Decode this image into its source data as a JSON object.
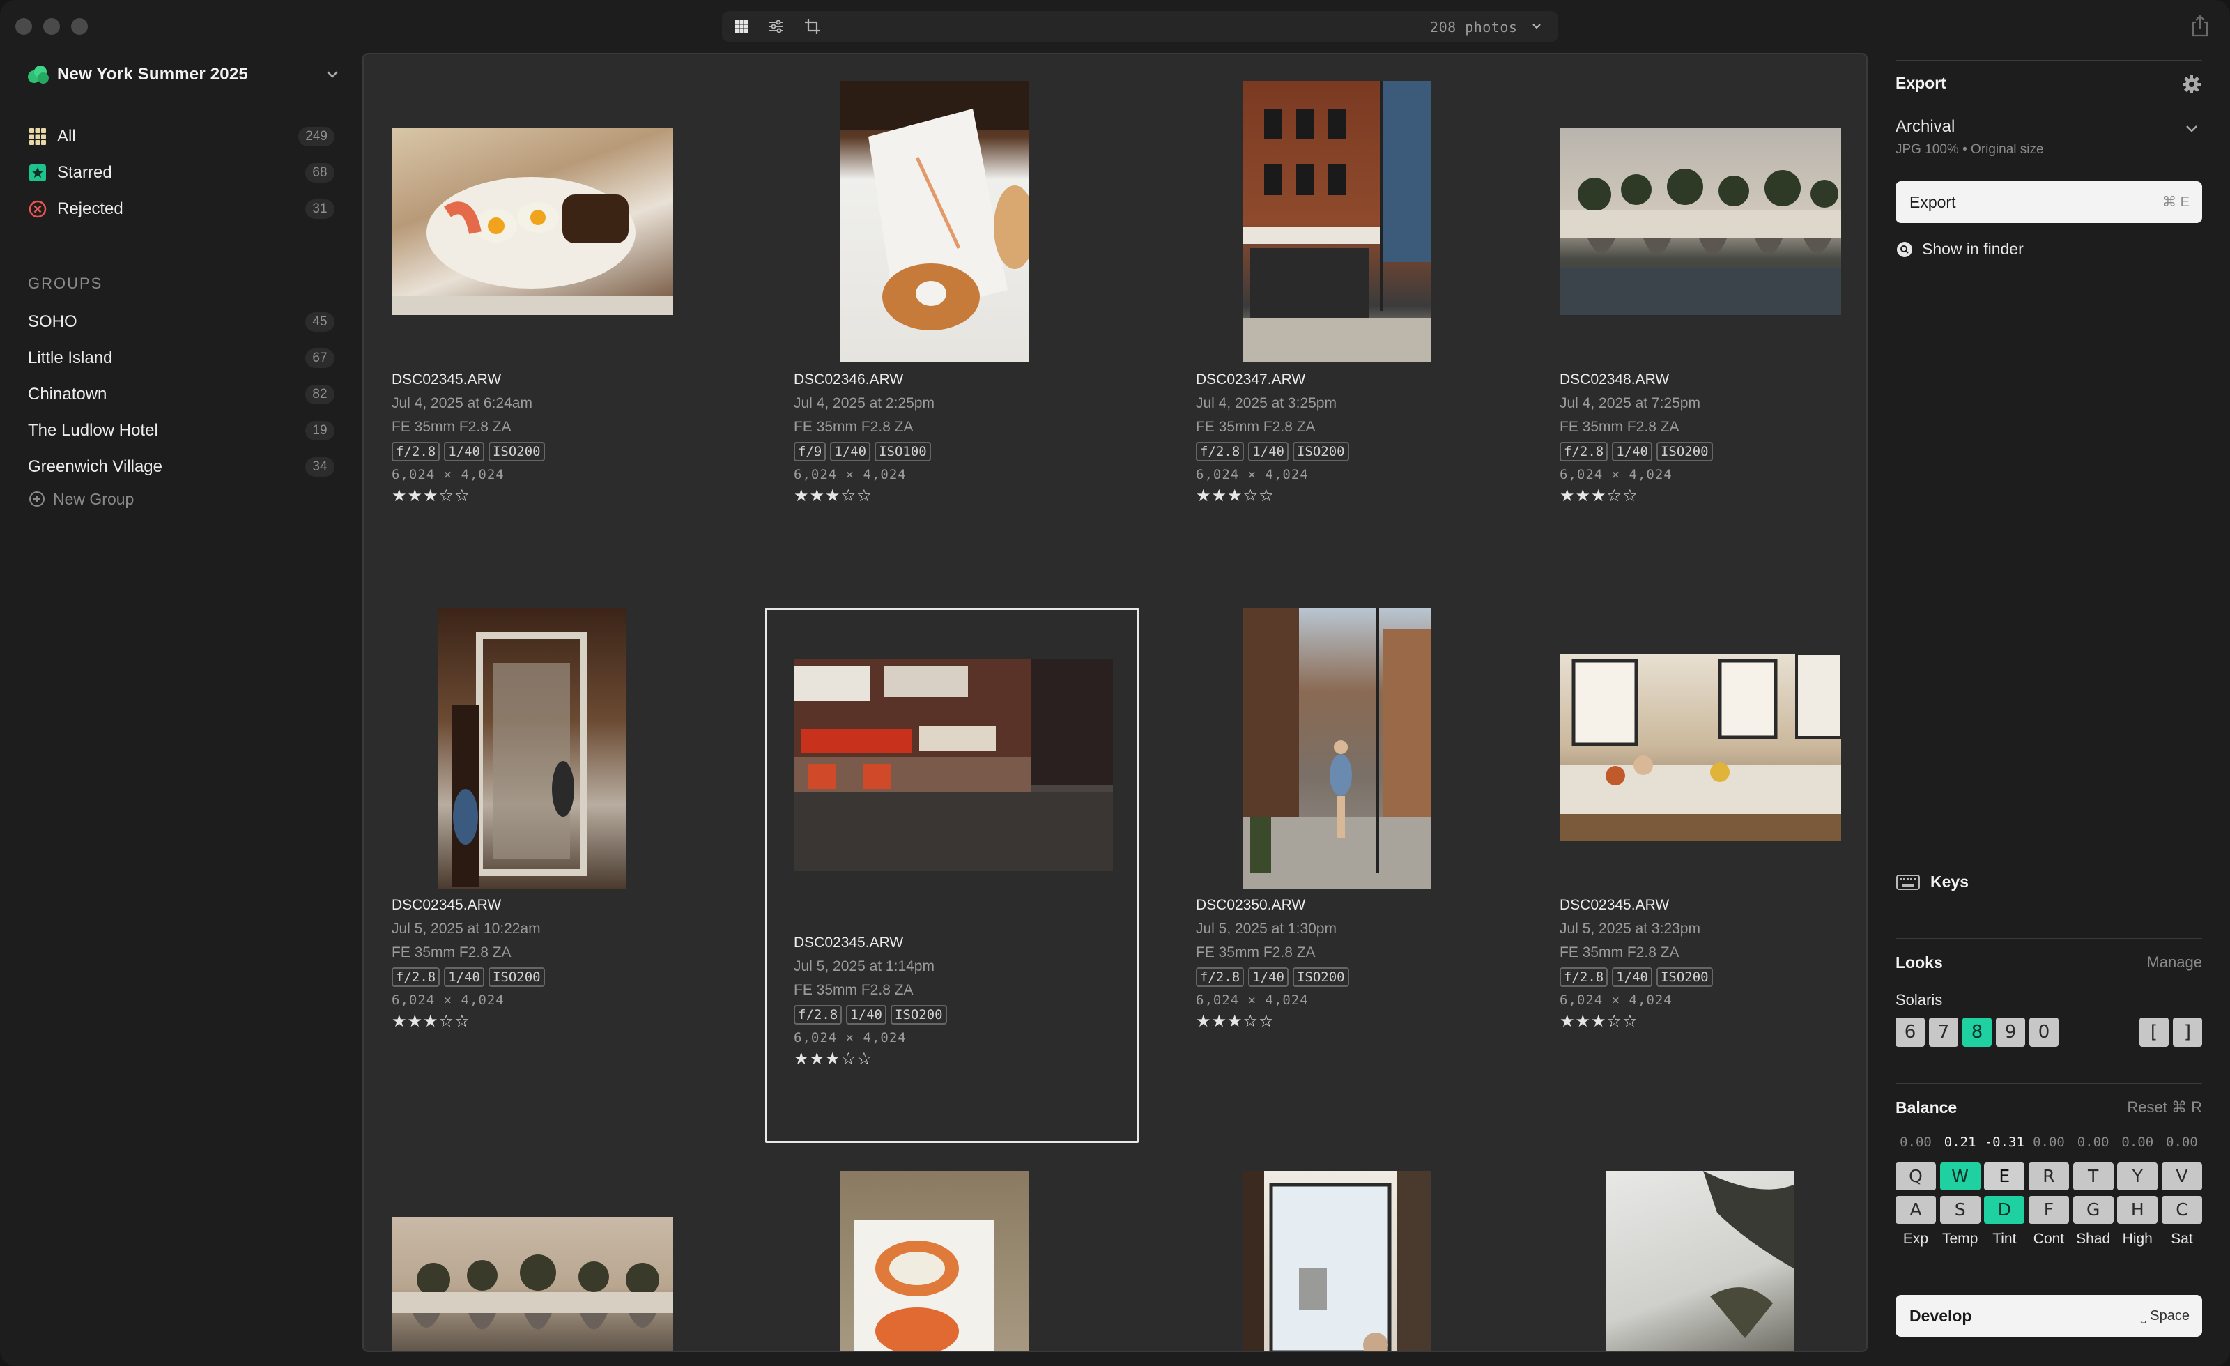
{
  "toolbar": {
    "photo_count": "208 photos"
  },
  "sidebar": {
    "project_name": "New York Summer 2025",
    "nav": [
      {
        "label": "All",
        "count": "249"
      },
      {
        "label": "Starred",
        "count": "68"
      },
      {
        "label": "Rejected",
        "count": "31"
      }
    ],
    "groups_heading": "GROUPS",
    "groups": [
      {
        "label": "SOHO",
        "count": "45"
      },
      {
        "label": "Little Island",
        "count": "67"
      },
      {
        "label": "Chinatown",
        "count": "82"
      },
      {
        "label": "The Ludlow Hotel",
        "count": "19"
      },
      {
        "label": "Greenwich Village",
        "count": "34"
      }
    ],
    "new_group_label": "New Group"
  },
  "photos": [
    {
      "file": "DSC02345.ARW",
      "date": "Jul 4, 2025 at 6:24am",
      "lens": "FE 35mm F2.8 ZA",
      "aperture": "f/2.8",
      "shutter": "1/40",
      "iso": "ISO200",
      "dims": "6,024 × 4,024",
      "stars": "★★★☆☆",
      "rating": 3
    },
    {
      "file": "DSC02346.ARW",
      "date": "Jul 4, 2025 at 2:25pm",
      "lens": "FE 35mm F2.8 ZA",
      "aperture": "f/9",
      "shutter": "1/40",
      "iso": "ISO100",
      "dims": "6,024 × 4,024",
      "stars": "★★★☆☆",
      "rating": 3
    },
    {
      "file": "DSC02347.ARW",
      "date": "Jul 4, 2025 at 3:25pm",
      "lens": "FE 35mm F2.8 ZA",
      "aperture": "f/2.8",
      "shutter": "1/40",
      "iso": "ISO200",
      "dims": "6,024 × 4,024",
      "stars": "★★★☆☆",
      "rating": 3
    },
    {
      "file": "DSC02348.ARW",
      "date": "Jul 4, 2025 at 7:25pm",
      "lens": "FE 35mm F2.8 ZA",
      "aperture": "f/2.8",
      "shutter": "1/40",
      "iso": "ISO200",
      "dims": "6,024 × 4,024",
      "stars": "★★★☆☆",
      "rating": 3
    },
    {
      "file": "DSC02345.ARW",
      "date": "Jul 5, 2025 at 10:22am",
      "lens": "FE 35mm F2.8 ZA",
      "aperture": "f/2.8",
      "shutter": "1/40",
      "iso": "ISO200",
      "dims": "6,024 × 4,024",
      "stars": "★★★☆☆",
      "rating": 3
    },
    {
      "file": "DSC02345.ARW",
      "date": "Jul 5, 2025 at 1:14pm",
      "lens": "FE 35mm F2.8 ZA",
      "aperture": "f/2.8",
      "shutter": "1/40",
      "iso": "ISO200",
      "dims": "6,024 × 4,024",
      "stars": "★★★☆☆",
      "rating": 3
    },
    {
      "file": "DSC02350.ARW",
      "date": "Jul 5, 2025 at 1:30pm",
      "lens": "FE 35mm F2.8 ZA",
      "aperture": "f/2.8",
      "shutter": "1/40",
      "iso": "ISO200",
      "dims": "6,024 × 4,024",
      "stars": "★★★☆☆",
      "rating": 3
    },
    {
      "file": "DSC02345.ARW",
      "date": "Jul 5, 2025 at 3:23pm",
      "lens": "FE 35mm F2.8 ZA",
      "aperture": "f/2.8",
      "shutter": "1/40",
      "iso": "ISO200",
      "dims": "6,024 × 4,024",
      "stars": "★★★☆☆",
      "rating": 3
    }
  ],
  "export": {
    "title": "Export",
    "preset_name": "Archival",
    "preset_detail": "JPG 100% • Original size",
    "button_label": "Export",
    "button_shortcut": "⌘ E",
    "show_in_finder": "Show in finder"
  },
  "keys_label": "Keys",
  "looks": {
    "title": "Looks",
    "manage": "Manage",
    "current": "Solaris",
    "keys": [
      "6",
      "7",
      "8",
      "9",
      "0"
    ],
    "active_key": "8",
    "bracket_keys": [
      "[",
      "]"
    ]
  },
  "balance": {
    "title": "Balance",
    "reset": "Reset",
    "reset_shortcut": "⌘ R",
    "values": [
      "0.00",
      "0.21",
      "-0.31",
      "0.00",
      "0.00",
      "0.00",
      "0.00"
    ],
    "top_keys": [
      "Q",
      "W",
      "E",
      "R",
      "T",
      "Y",
      "V"
    ],
    "bottom_keys": [
      "A",
      "S",
      "D",
      "F",
      "G",
      "H",
      "C"
    ],
    "labels": [
      "Exp",
      "Temp",
      "Tint",
      "Cont",
      "Shad",
      "High",
      "Sat"
    ]
  },
  "develop": {
    "label": "Develop",
    "shortcut": "⎵ Space"
  },
  "colors": {
    "accent_green": "#1fd0a0",
    "panel_bg": "#2c2c2c",
    "sidebar_bg": "#1d1d1d"
  }
}
